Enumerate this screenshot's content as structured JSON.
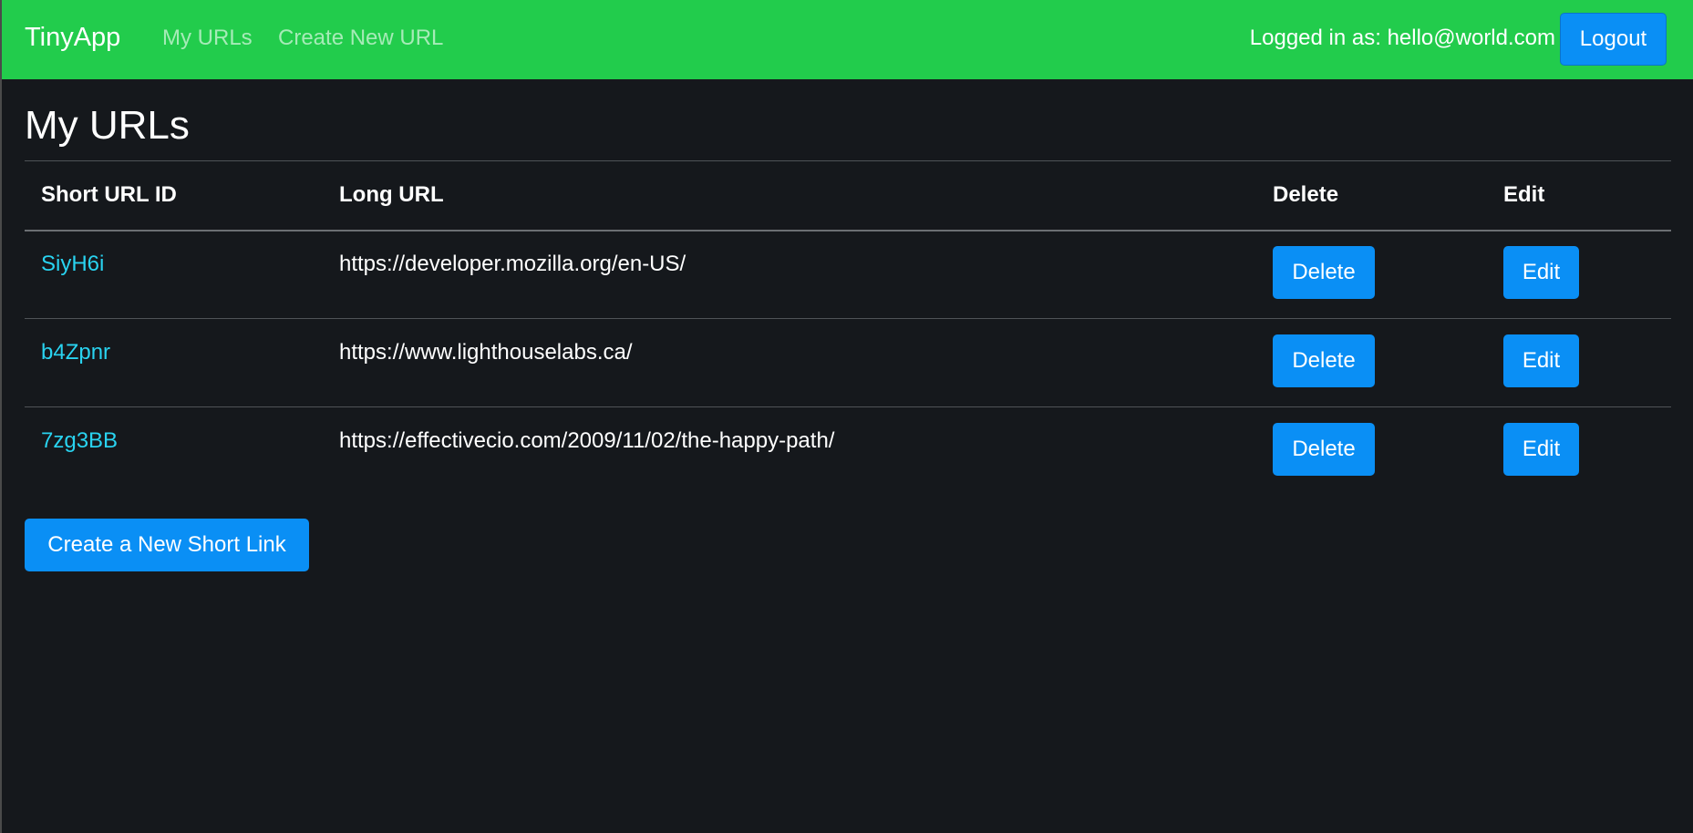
{
  "navbar": {
    "brand": "TinyApp",
    "links": [
      "My URLs",
      "Create New URL"
    ],
    "login_text": "Logged in as: hello@world.com",
    "logout_label": "Logout",
    "background_color": "#22cc4c"
  },
  "main": {
    "title": "My URLs",
    "table": {
      "headers": [
        "Short URL ID",
        "Long URL",
        "Delete",
        "Edit"
      ],
      "rows": [
        {
          "id": "SiyH6i",
          "long_url": "https://developer.mozilla.org/en-US/",
          "delete_label": "Delete",
          "edit_label": "Edit"
        },
        {
          "id": "b4Zpnr",
          "long_url": "https://www.lighthouselabs.ca/",
          "delete_label": "Delete",
          "edit_label": "Edit"
        },
        {
          "id": "7zg3BB",
          "long_url": "https://effectivecio.com/2009/11/02/the-happy-path/",
          "delete_label": "Delete",
          "edit_label": "Edit"
        }
      ]
    },
    "create_button_label": "Create a New Short Link"
  },
  "colors": {
    "page_background": "#15181c",
    "primary_button": "#0a8ff5",
    "link": "#29d3f0"
  }
}
